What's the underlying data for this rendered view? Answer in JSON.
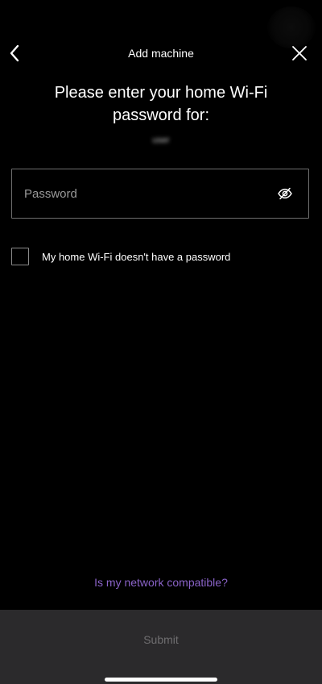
{
  "header": {
    "title": "Add machine",
    "back_icon": "chevron-left-icon",
    "close_icon": "close-icon"
  },
  "content": {
    "heading_line1": "Please enter your home Wi-Fi",
    "heading_line2": "password for:",
    "network_name": "user"
  },
  "password": {
    "placeholder": "Password",
    "value": "",
    "toggle_icon": "eye-slash-icon"
  },
  "no_password_option": {
    "label": "My home Wi-Fi doesn't have a password",
    "checked": false
  },
  "links": {
    "compatibility": "Is my network compatible?"
  },
  "footer": {
    "submit_label": "Submit"
  },
  "colors": {
    "background": "#000000",
    "link": "#8a63c8",
    "footer_background": "#2b2a2c",
    "submit_disabled_text": "#6f6e70"
  }
}
